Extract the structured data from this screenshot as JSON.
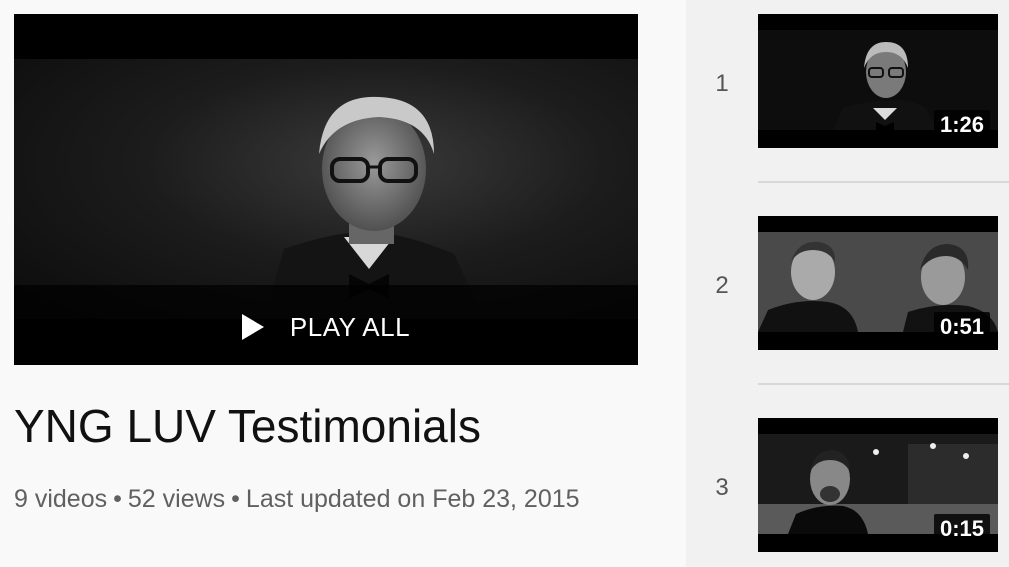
{
  "playlist": {
    "title": "YNG LUV Testimonials",
    "video_count": "9 videos",
    "views": "52 views",
    "updated": "Last updated on Feb 23, 2015",
    "play_all_label": "PLAY ALL",
    "separator": "•"
  },
  "videos": [
    {
      "index": "1",
      "duration": "1:26"
    },
    {
      "index": "2",
      "duration": "0:51"
    },
    {
      "index": "3",
      "duration": "0:15"
    }
  ],
  "colors": {
    "page_bg": "#f9f9f9",
    "sidebar_bg": "#f1f1f1",
    "title_text": "#111111",
    "meta_text": "#606060"
  }
}
